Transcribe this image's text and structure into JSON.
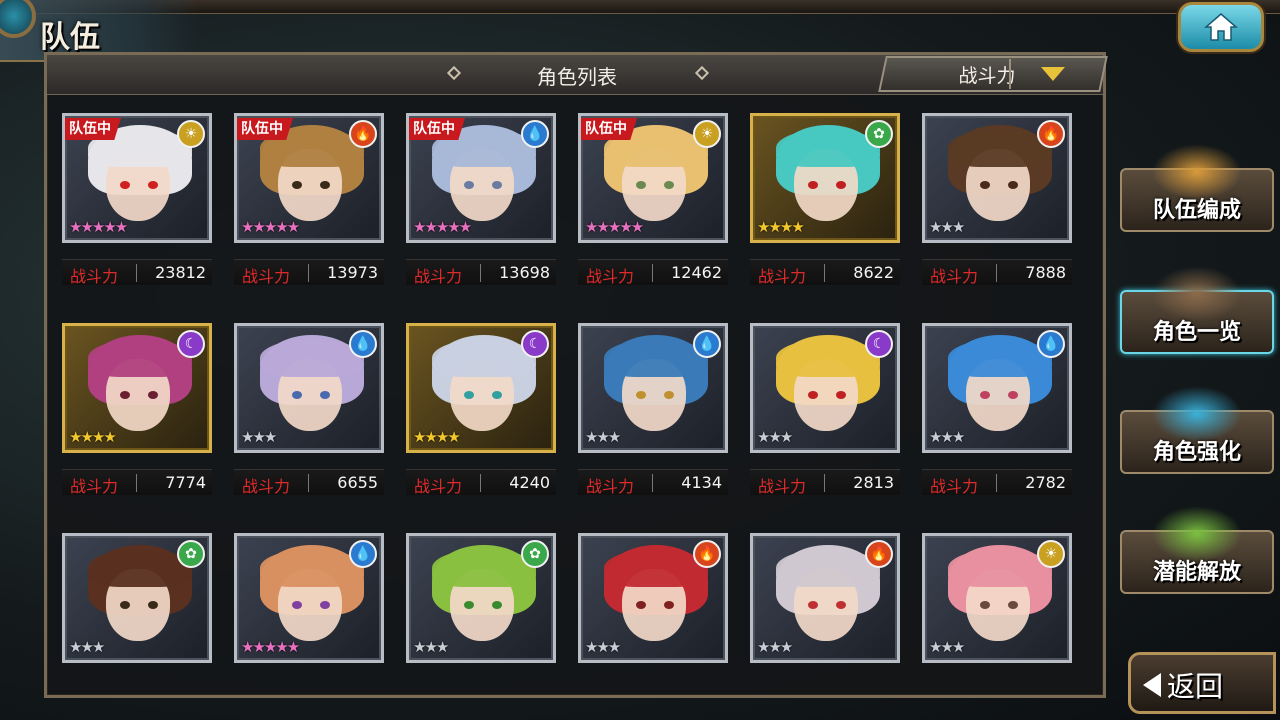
{
  "header": {
    "title": "队伍"
  },
  "list_panel": {
    "title": "角色列表",
    "sort": {
      "selected": "战斗力"
    }
  },
  "power_label": "战斗力",
  "badge_text": "队伍中",
  "elements": {
    "light": {
      "glyph": "☀",
      "color": "#c9a020"
    },
    "fire": {
      "glyph": "🔥",
      "color": "#d8451c"
    },
    "water": {
      "glyph": "💧",
      "color": "#2a7ad0"
    },
    "wind": {
      "glyph": "✿",
      "color": "#3aa84a"
    },
    "dark": {
      "glyph": "☾",
      "color": "#8a3ac8"
    }
  },
  "characters": [
    {
      "element": "light",
      "in_team": true,
      "stars": 5,
      "power": "23812",
      "frame": "silver",
      "hair": "#e6e6ea",
      "eyes": "#d02020"
    },
    {
      "element": "fire",
      "in_team": true,
      "stars": 5,
      "power": "13973",
      "frame": "silver",
      "hair": "#b08040",
      "eyes": "#3a2a1a"
    },
    {
      "element": "water",
      "in_team": true,
      "stars": 5,
      "power": "13698",
      "frame": "silver",
      "hair": "#a8b8d8",
      "eyes": "#6a7aa0"
    },
    {
      "element": "light",
      "in_team": true,
      "stars": 5,
      "power": "12462",
      "frame": "silver",
      "hair": "#e8c070",
      "eyes": "#6a8a50"
    },
    {
      "element": "wind",
      "in_team": false,
      "stars": 4,
      "power": "8622",
      "frame": "gold",
      "hair": "#48c8c0",
      "eyes": "#c02020"
    },
    {
      "element": "fire",
      "in_team": false,
      "stars": 3,
      "power": "7888",
      "frame": "silver",
      "hair": "#5a3a24",
      "eyes": "#4a2a1a"
    },
    {
      "element": "dark",
      "in_team": false,
      "stars": 4,
      "power": "7774",
      "frame": "gold",
      "hair": "#b04080",
      "eyes": "#6a2030"
    },
    {
      "element": "water",
      "in_team": false,
      "stars": 3,
      "power": "6655",
      "frame": "silver",
      "hair": "#b8a8d8",
      "eyes": "#4a6ab0"
    },
    {
      "element": "dark",
      "in_team": false,
      "stars": 4,
      "power": "4240",
      "frame": "gold",
      "hair": "#c8d0e0",
      "eyes": "#30a0a0"
    },
    {
      "element": "water",
      "in_team": false,
      "stars": 3,
      "power": "4134",
      "frame": "silver",
      "hair": "#3a7ab8",
      "eyes": "#c09030"
    },
    {
      "element": "dark",
      "in_team": false,
      "stars": 3,
      "power": "2813",
      "frame": "silver",
      "hair": "#e8c040",
      "eyes": "#c02020"
    },
    {
      "element": "water",
      "in_team": false,
      "stars": 3,
      "power": "2782",
      "frame": "silver",
      "hair": "#3a8ad8",
      "eyes": "#c04060"
    },
    {
      "element": "wind",
      "in_team": false,
      "stars": 3,
      "power": "",
      "frame": "silver",
      "hair": "#5a3020",
      "eyes": "#3a2a1a"
    },
    {
      "element": "water",
      "in_team": false,
      "stars": 5,
      "power": "",
      "frame": "silver",
      "hair": "#d89060",
      "eyes": "#8040a0"
    },
    {
      "element": "wind",
      "in_team": false,
      "stars": 3,
      "power": "",
      "frame": "silver",
      "hair": "#8ac040",
      "eyes": "#3a8a30"
    },
    {
      "element": "fire",
      "in_team": false,
      "stars": 3,
      "power": "",
      "frame": "silver",
      "hair": "#c02a30",
      "eyes": "#802020"
    },
    {
      "element": "fire",
      "in_team": false,
      "stars": 3,
      "power": "",
      "frame": "silver",
      "hair": "#d0c8d0",
      "eyes": "#c03030"
    },
    {
      "element": "light",
      "in_team": false,
      "stars": 3,
      "power": "",
      "frame": "silver",
      "hair": "#e890a0",
      "eyes": "#6a4a3a"
    }
  ],
  "side_menu": [
    {
      "label": "队伍编成",
      "active": false
    },
    {
      "label": "角色一览",
      "active": true
    },
    {
      "label": "角色强化",
      "active": false
    },
    {
      "label": "潜能解放",
      "active": false
    }
  ],
  "back": {
    "label": "返回"
  }
}
